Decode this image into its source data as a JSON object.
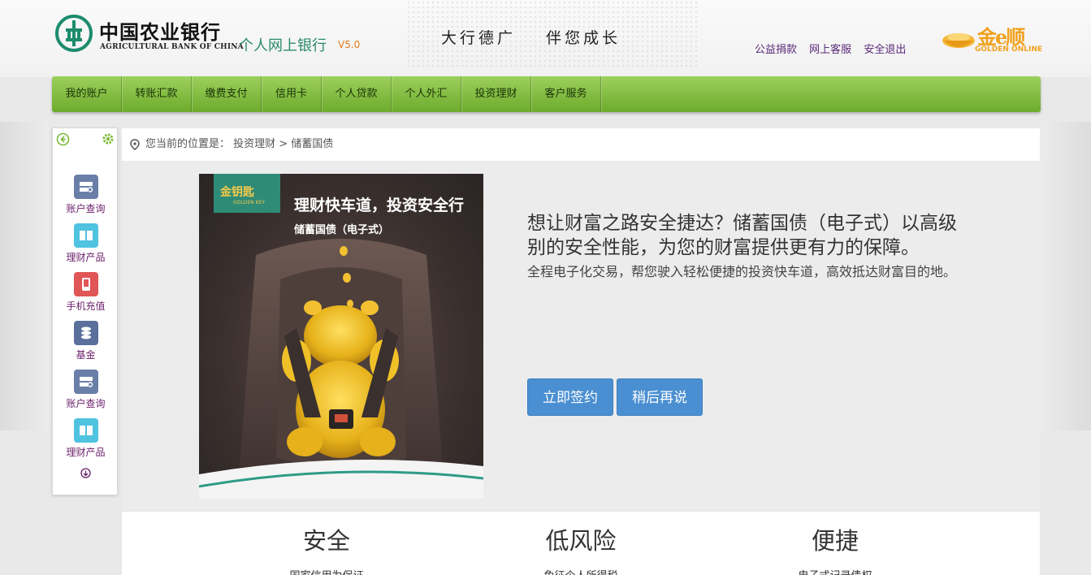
{
  "header": {
    "bank_name_cn": "中国农业银行",
    "bank_name_en": "AGRICULTURAL BANK OF CHINA",
    "site_title": "个人网上银行",
    "version": "V5.0",
    "slogan_left": "大行德广",
    "slogan_right": "伴您成长",
    "links": [
      "公益捐款",
      "网上客服",
      "安全退出"
    ],
    "golden_brand": "金e顺",
    "golden_sub": "GOLDEN ONLINE"
  },
  "nav": {
    "items": [
      "我的账户",
      "转账汇款",
      "缴费支付",
      "信用卡",
      "个人贷款",
      "个人外汇",
      "投资理财",
      "客户服务"
    ]
  },
  "sidebar": {
    "items": [
      {
        "label": "账户查询",
        "icon": "account-query-icon",
        "color": "#6a7fa8"
      },
      {
        "label": "理财产品",
        "icon": "wealth-product-icon",
        "color": "#4fc3e0"
      },
      {
        "label": "手机充值",
        "icon": "phone-recharge-icon",
        "color": "#e05555"
      },
      {
        "label": "基金",
        "icon": "fund-icon",
        "color": "#5a6f9c"
      },
      {
        "label": "账户查询",
        "icon": "account-query-icon",
        "color": "#6a7fa8"
      },
      {
        "label": "理财产品",
        "icon": "wealth-product-icon",
        "color": "#4fc3e0"
      }
    ]
  },
  "breadcrumb": {
    "prefix": "您当前的位置是：",
    "path": "投资理财 > 储蓄国债"
  },
  "promo": {
    "poster_badge": "金钥匙",
    "poster_badge_sub": "GOLDEN KEY",
    "poster_headline": "理财快车道，投资安全行",
    "poster_subhead": "储蓄国债（电子式）",
    "title": "想让财富之路安全捷达？储蓄国债（电子式）以高级别的安全性能，为您的财富提供更有力的保障。",
    "description": "全程电子化交易，帮您驶入轻松便捷的投资快车道，高效抵达财富目的地。",
    "sign_button": "立即签约",
    "later_button": "稍后再说"
  },
  "features": [
    {
      "title": "安全",
      "subtitle": "国家信用为保证"
    },
    {
      "title": "低风险",
      "subtitle": "免征个人所得税"
    },
    {
      "title": "便捷",
      "subtitle": "电子式记录债权"
    }
  ],
  "colors": {
    "nav_green": "#7dbb3c",
    "brand_teal": "#2b8a6e",
    "button_blue": "#4a8fd1",
    "link_purple": "#5a2a7a",
    "golden": "#f0a11c"
  }
}
